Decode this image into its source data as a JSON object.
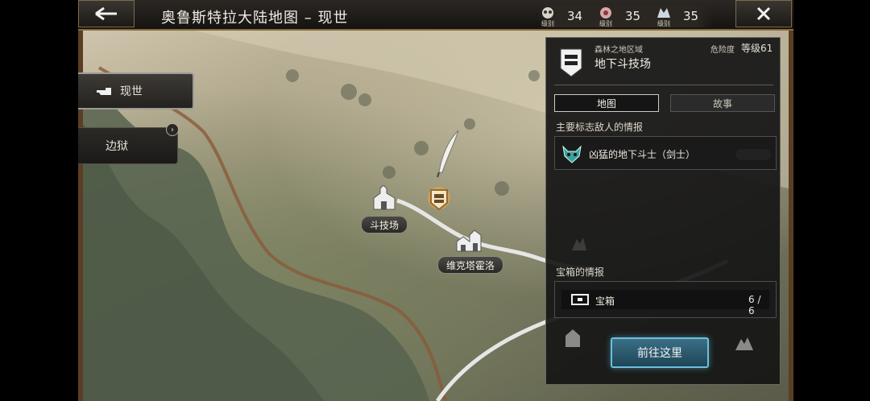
{
  "header": {
    "title": "奥鲁斯特拉大陆地图 – 现世",
    "levels": [
      {
        "icon": "skull-crest-icon",
        "caption": "级别",
        "value": "34"
      },
      {
        "icon": "rose-crest-icon",
        "caption": "级别",
        "value": "35"
      },
      {
        "icon": "wolf-crest-icon",
        "caption": "级别",
        "value": "35"
      }
    ]
  },
  "side_tabs": {
    "now_label": "现世",
    "limbo_label": "边狱"
  },
  "map": {
    "places": [
      {
        "label": "斗技场"
      },
      {
        "label": "维克塔霍洛"
      }
    ]
  },
  "panel": {
    "region": "森林之地区域",
    "danger_label": "危险度",
    "level_label": "等级61",
    "name": "地下斗技场",
    "tab_map": "地图",
    "tab_story": "故事",
    "enemy_section": "主要标志敌人的情报",
    "enemy_name": "凶猛的地下斗士（剑士）",
    "chest_section": "宝箱的情报",
    "chest_name": "宝箱",
    "chest_count": "6 / 6",
    "go_button": "前往这里"
  },
  "colors": {
    "accent_button": "#3b6f86",
    "frame_gold": "#8a6b3c",
    "map_road": "#e6e6e6"
  }
}
